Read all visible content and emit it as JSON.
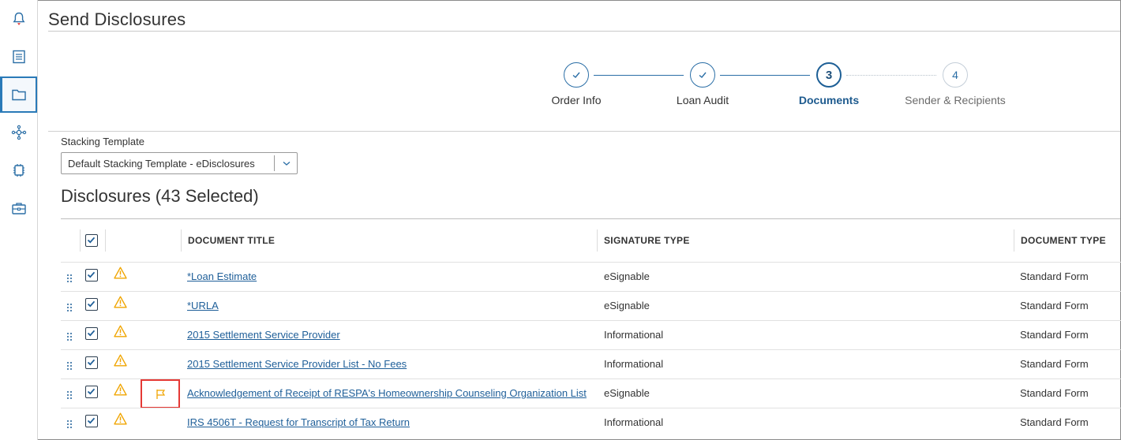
{
  "page": {
    "title": "Send Disclosures"
  },
  "sidebar": {
    "items": [
      {
        "icon": "bell-icon"
      },
      {
        "icon": "list-icon"
      },
      {
        "icon": "folder-icon",
        "active": true
      },
      {
        "icon": "network-icon"
      },
      {
        "icon": "chip-icon"
      },
      {
        "icon": "briefcase-icon"
      }
    ]
  },
  "stepper": {
    "steps": [
      {
        "number": "✓",
        "label": "Order Info",
        "state": "done"
      },
      {
        "number": "✓",
        "label": "Loan Audit",
        "state": "done"
      },
      {
        "number": "3",
        "label": "Documents",
        "state": "current"
      },
      {
        "number": "4",
        "label": "Sender & Recipients",
        "state": "future"
      }
    ]
  },
  "stacking": {
    "label": "Stacking Template",
    "selected": "Default Stacking Template - eDisclosures"
  },
  "disclosures": {
    "title": "Disclosures (43 Selected)",
    "columns": [
      "DOCUMENT TITLE",
      "SIGNATURE TYPE",
      "DOCUMENT TYPE"
    ],
    "rows": [
      {
        "title": "*Loan Estimate",
        "signature": "eSignable",
        "type": "Standard Form",
        "checked": true,
        "warning": true,
        "flag": false
      },
      {
        "title": "*URLA",
        "signature": "eSignable",
        "type": "Standard Form",
        "checked": true,
        "warning": true,
        "flag": false
      },
      {
        "title": "2015 Settlement Service Provider",
        "signature": "Informational",
        "type": "Standard Form",
        "checked": true,
        "warning": true,
        "flag": false
      },
      {
        "title": "2015 Settlement Service Provider List - No Fees",
        "signature": "Informational",
        "type": "Standard Form",
        "checked": true,
        "warning": true,
        "flag": false
      },
      {
        "title": "Acknowledgement of Receipt of RESPA's Homeownership Counseling Organization List",
        "signature": "eSignable",
        "type": "Standard Form",
        "checked": true,
        "warning": true,
        "flag": true
      },
      {
        "title": "IRS 4506T - Request for Transcript of Tax Return",
        "signature": "Informational",
        "type": "Standard Form",
        "checked": true,
        "warning": true,
        "flag": false
      }
    ]
  },
  "colors": {
    "accent": "#2a6ea6",
    "warning": "#f0a500",
    "flagHighlight": "#e53935"
  }
}
